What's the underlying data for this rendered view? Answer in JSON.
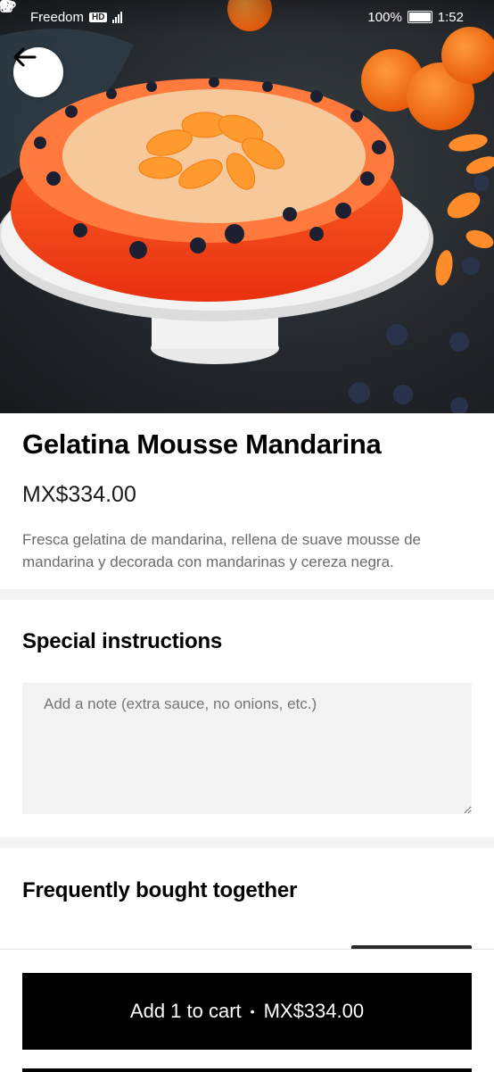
{
  "status_bar": {
    "carrier": "Freedom",
    "carrier_badge": "HD",
    "battery": "100%",
    "time": "1:52"
  },
  "hero": {
    "image": "orange-mandarin-gelatin-cake-on-white-stand",
    "back_icon": "arrow-left-icon"
  },
  "item": {
    "title": "Gelatina Mousse Mandarina",
    "price": "MX$334.00",
    "description": "Fresca gelatina de mandarina, rellena de suave mousse de mandarina y decorada con mandarinas y cereza negra."
  },
  "special_instructions": {
    "title": "Special instructions",
    "placeholder": "Add a note (extra sauce, no onions, etc.)"
  },
  "frequently_bought": {
    "title": "Frequently bought together"
  },
  "cart_button": {
    "label": "Add 1 to cart",
    "separator": "•",
    "price": "MX$334.00"
  },
  "colors": {
    "primary": "#000000",
    "divider": "#f3f3f3",
    "muted_text": "#6b6b6b"
  }
}
